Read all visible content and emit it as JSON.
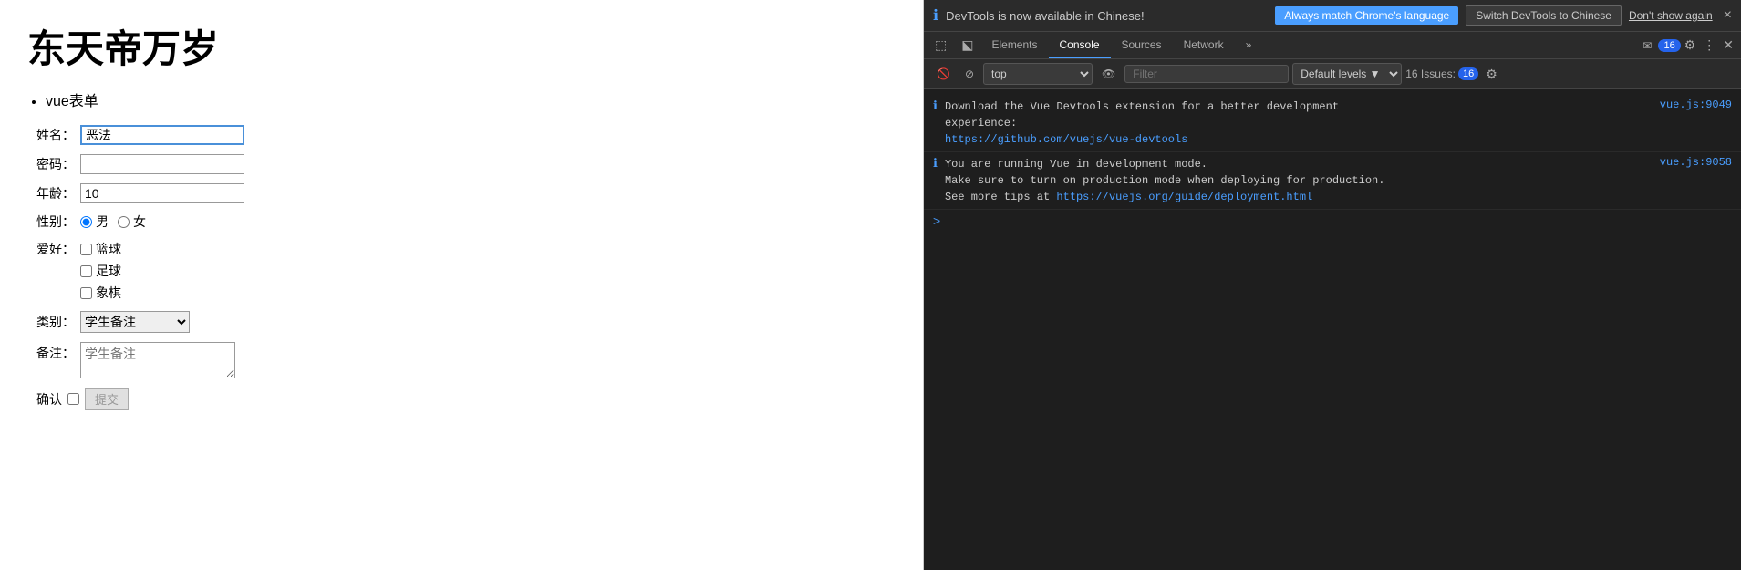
{
  "webpage": {
    "title": "东天帝万岁",
    "subtitle_bullet": "vue表单",
    "form": {
      "name_label": "姓名：",
      "name_value": "恶法",
      "password_label": "密码：",
      "password_value": "",
      "age_label": "年龄：",
      "age_value": "10",
      "gender_label": "性别：",
      "gender_male": "男",
      "gender_female": "女",
      "hobby_label": "爱好：",
      "hobbies": [
        "篮球",
        "足球",
        "象棋"
      ],
      "category_label": "类别：",
      "category_options": [
        "学生备注"
      ],
      "category_selected": "学生备注",
      "notes_label": "备注：",
      "notes_placeholder": "学生备注",
      "confirm_label": "确认",
      "submit_label": "提交"
    }
  },
  "devtools": {
    "notification": {
      "icon": "ℹ",
      "text": "DevTools is now available in Chinese!",
      "btn_match": "Always match Chrome's language",
      "btn_switch": "Switch DevTools to Chinese",
      "btn_dismiss": "Don't show again",
      "close": "×"
    },
    "tabs": {
      "items": [
        "Elements",
        "Console",
        "Sources",
        "Network",
        "»"
      ],
      "active": "Console",
      "badge_label": "16",
      "settings_icon": "⚙",
      "more_icon": "⋮"
    },
    "toolbar": {
      "top_label": "top",
      "filter_placeholder": "Filter",
      "levels_label": "Default levels ▼",
      "issues_label": "16 Issues:",
      "issues_count": "16"
    },
    "console": {
      "messages": [
        {
          "text": "Download the Vue Devtools extension for a better development\nexperience:",
          "link": "https://github.com/vuejs/vue-devtools",
          "source": "vue.js:9049"
        },
        {
          "text": "You are running Vue in development mode.\nMake sure to turn on production mode when deploying for production.\nSee more tips at ",
          "link": "https://vuejs.org/guide/deployment.html",
          "source": "vue.js:9058"
        }
      ],
      "prompt": ">"
    }
  }
}
